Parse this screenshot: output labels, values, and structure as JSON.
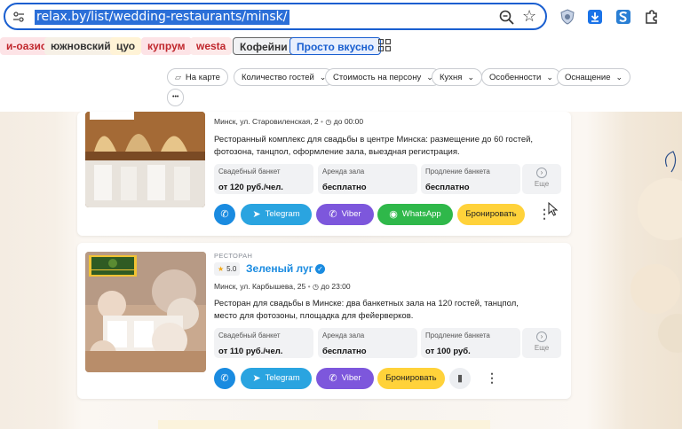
{
  "browser": {
    "url": "relax.by/list/wedding-restaurants/minsk/"
  },
  "bookmarks": [
    {
      "label": "и-оазис",
      "bg": "#fde3e6",
      "color": "#c0272d"
    },
    {
      "label": "южновский",
      "bg": "#f6f0e6",
      "color": "#333333"
    },
    {
      "label": "цуо",
      "bg": "#fff3d6",
      "color": "#333333"
    },
    {
      "label": "купрум",
      "bg": "#fde3e6",
      "color": "#c0272d"
    },
    {
      "label": "westa",
      "bg": "#fde9e9",
      "color": "#c0272d"
    },
    {
      "label": "Кофейни",
      "bg": "#f1f2f4",
      "color": "#333333"
    },
    {
      "label": "Просто вкусно",
      "bg": "#e8effd",
      "color": "#1a5fd0"
    }
  ],
  "filters": {
    "map": "На карте",
    "guests": "Количество гостей",
    "price": "Стоимость на персону",
    "cuisine": "Кухня",
    "features": "Особенности",
    "equipment": "Оснащение",
    "more": "•••"
  },
  "card1": {
    "address": "Минск, ул. Старовиленская, 2",
    "hours": "до 00:00",
    "description": "Ресторанный комплекс для свадьбы в центре Минска: размещение до 60 гостей, фотозона, танцпол, оформление зала, выездная регистрация.",
    "banquet_label": "Свадебный банкет",
    "banquet_value": "от 120 руб./чел.",
    "rent_label": "Аренда зала",
    "rent_value": "бесплатно",
    "extend_label": "Продление банкета",
    "extend_value": "бесплатно",
    "more_label": "Еще",
    "telegram": "Telegram",
    "viber": "Viber",
    "whatsapp": "WhatsApp",
    "book": "Бронировать"
  },
  "card2": {
    "kind": "РЕСТОРАН",
    "rating": "5.0",
    "name": "Зеленый луг",
    "address": "Минск, ул. Карбышева, 25",
    "hours": "до 23:00",
    "description": "Ресторан для свадьбы в Минске: два банкетных зала на 120 гостей, танцпол, место для фотозоны, площадка для фейерверков.",
    "banquet_label": "Свадебный банкет",
    "banquet_value": "от 110 руб./чел.",
    "rent_label": "Аренда зала",
    "rent_value": "бесплатно",
    "extend_label": "Продление банкета",
    "extend_value": "от 100 руб.",
    "more_label": "Еще",
    "telegram": "Telegram",
    "viber": "Viber",
    "book": "Бронировать"
  },
  "colors": {
    "accent": "#1a8be0",
    "telegram": "#2aa4e0",
    "viber": "#7d57dc",
    "whatsapp": "#2fb84a",
    "book": "#ffd23a"
  }
}
